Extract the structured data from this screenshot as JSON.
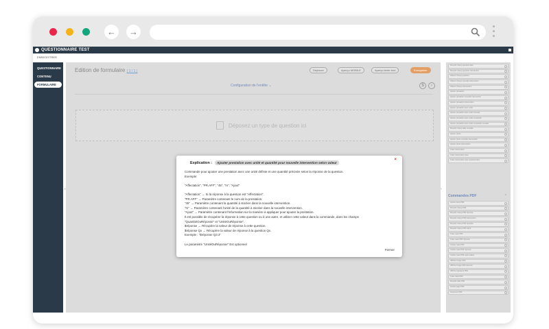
{
  "browser": {
    "dot_colors": [
      "#e8264a",
      "#f5b31a",
      "#15a57c"
    ],
    "back_icon": "arrow-left-icon",
    "forward_icon": "arrow-right-icon",
    "search_icon": "search-icon"
  },
  "app": {
    "title": "QUESTIONNAIRE TEST",
    "sub_label": "ENREGISTRER"
  },
  "sidebar": {
    "items": [
      {
        "label": "QUESTIONNAIRE"
      },
      {
        "label": "CONTENU"
      },
      {
        "label": "FORMULAIRE"
      }
    ]
  },
  "main": {
    "title": "Edition de formulaire",
    "count": "( 1 / 1 )",
    "buttons": {
      "deplacer": "Déplacer",
      "apercu_mobile": "Aperçu MOBILE",
      "apercu_texte": "Aperçu texte brut",
      "enregistrer": "Enregistrer"
    },
    "config_label": "Configuration de l'entête",
    "dropzone_label": "Déposez un type de question ici"
  },
  "rpanel": {
    "items_top": [
      "Remplir champ questionnaire",
      "Remplir champ question intervention",
      "Obtenir champ question",
      "Obtenir champ nouvelle intervention",
      "Obtenir champ intervention",
      "Ajouter prestation",
      "Ajouter prestation nouvelle intervention",
      "Ajouter prestation intervention",
      "Ajouter prestation avec unité",
      "Ajouter prestation avec unité nouvelle",
      "Ajouter prestation avec unité et quantité",
      "Ajouter prestation avec unité et quantité nouvelle",
      "Remplir champ date nouvelle",
      "Ajouter photo",
      "Ajouter photo nouvelle intervention",
      "Ajouter photo intervention",
      "Créer intervention",
      "Créer intervention avec",
      "Créer intervention avec questionnaire"
    ],
    "section_title": "Commandes PDF",
    "items_pdf": [
      "Ajouter texte PDF",
      "Remplir champ PDF",
      "Remplir champ PDF réponse",
      "Remplir champ PDF intervention",
      "Remplir champ PDF question",
      "Remplir champ PDF client",
      "Créer case PDF",
      "Créer case PDF réponse",
      "Cocher case PDF",
      "Cocher case PDF réponse",
      "Cocher case PDF selon valeur",
      "Afficher image PDF",
      "Afficher image PDF réponse",
      "Afficher signature PDF",
      "Créer table PDF",
      "Remplir table PDF",
      "Insérer page PDF",
      "Fusionner PDF"
    ]
  },
  "modal": {
    "heading": "Explication :",
    "tag": "Ajouter prestation avec unité et quantité pour nouvelle intervention selon valeur",
    "lines": [
      "Commande pour ajouter une prestation avec une unité définie et une quantité précisée selon la réponse de la question.",
      "Exemple:",
      "",
      "\"Affectation\", \"PR.AFF\", \"45\", \"m\", \"Ajout\"",
      "",
      "\"Affectation\" → Si la réponse à la question est \"Affectation\".",
      "\"PR.AFF\" → Paramètre contenant le nom de la prestation.",
      "\"45\" → Paramètre contenant la quantité à stocker dans la nouvelle intervention.",
      "\"m\" → Paramètre contenant l'unité de la quantité à stocker dans la nouvelle intervention.",
      "\"Ajout\" → Paramètre contenant l'information sur la manière à appliquer pour ajouter la prestation.",
      "Il est possible de récupérer la réponse à cette question ou à une autre, et utiliser cette valeur dans la commande, dans les champs",
      "\"QuantitéOuRéponse\" et \"UnitéOuRéponse\".",
      "$réponse → Récupère la valeur de réponse à cette question.",
      "$réponse Qx → Récupère la valeur de réponse à la question Qx.",
      "Exemple : \"$réponse Q3.3\"",
      "",
      "Le paramètre \"UnitéOuRéponse\" Est optionnel"
    ],
    "close_label": "Fermer"
  }
}
